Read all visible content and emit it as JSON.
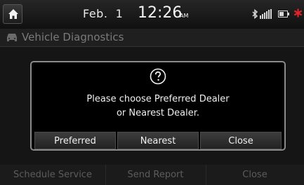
{
  "status": {
    "date_month": "Feb.",
    "date_day": "1",
    "time": "12:26",
    "time_suffix": "AM",
    "icons": [
      "home-icon",
      "bluetooth-icon",
      "signal-bars-icon",
      "battery-icon",
      "alert-asterisk-icon"
    ]
  },
  "screen": {
    "title": "Vehicle Diagnostics",
    "bottom_buttons": [
      "Schedule Service",
      "Send Report",
      "Close"
    ]
  },
  "dialog": {
    "message_line1": "Please choose Preferred Dealer",
    "message_line2": "or Nearest Dealer.",
    "buttons": [
      "Preferred",
      "Nearest",
      "Close"
    ]
  },
  "colors": {
    "background": "#151515",
    "dialog_border": "#8a8a8a",
    "alert": "#e0232b",
    "disabled_text": "#5c5c5c"
  }
}
